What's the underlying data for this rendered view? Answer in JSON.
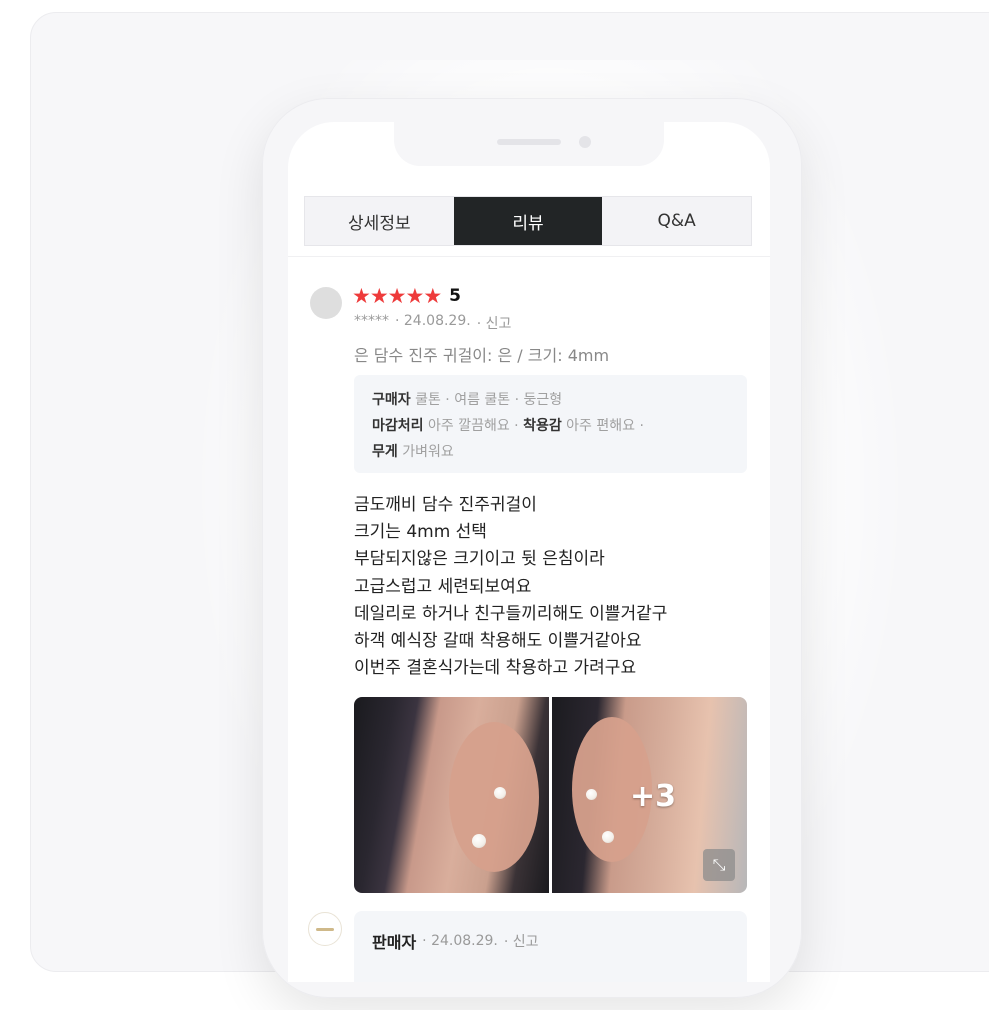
{
  "tabs": [
    {
      "label": "상세정보"
    },
    {
      "label": "리뷰"
    },
    {
      "label": "Q&A"
    }
  ],
  "review": {
    "stars": [
      "★",
      "★",
      "★",
      "★",
      "★"
    ],
    "rating": "5",
    "user": "*****",
    "date": "· 24.08.29.",
    "report": "· 신고",
    "option": "은 담수 진주 귀걸이: 은 / 크기: 4mm",
    "survey": {
      "buyer_label": "구매자",
      "buyer_value": "쿨톤 · 여름 쿨톤 · 둥근형",
      "finish_label": "마감처리",
      "finish_value": "아주 깔끔해요 ·",
      "wear_label": "착용감",
      "wear_value": "아주 편해요 ·",
      "weight_label": "무게",
      "weight_value": "가벼워요"
    },
    "body_lines": [
      "금도깨비 담수 진주귀걸이",
      "크기는 4mm 선택",
      "부담되지않은 크기이고 뒷 은침이라",
      "고급스럽고 세련되보여요",
      "데일리로 하거나 친구들끼리해도 이쁠거같구",
      "하객 예식장 갈때 착용해도 이쁠거같아요",
      "이번주 결혼식가는데 착용하고 가려구요"
    ],
    "more_photos": "+3"
  },
  "seller_reply": {
    "name": "판매자",
    "date": "· 24.08.29.",
    "report": "· 신고"
  }
}
